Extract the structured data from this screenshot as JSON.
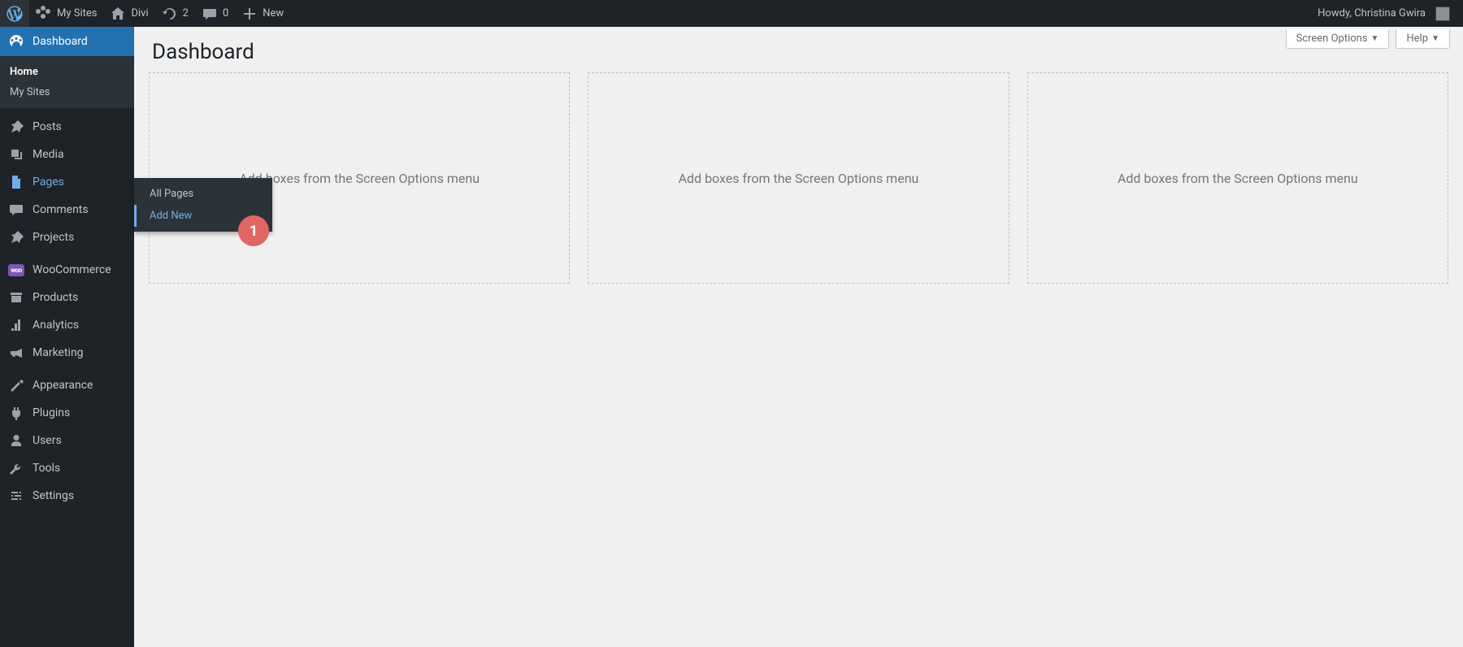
{
  "adminbar": {
    "my_sites": "My Sites",
    "site_name": "Divi",
    "updates_count": "2",
    "comments_count": "0",
    "new_label": "New",
    "greeting": "Howdy, Christina Gwira"
  },
  "sidebar": {
    "items": [
      {
        "label": "Dashboard"
      },
      {
        "label": "Posts"
      },
      {
        "label": "Media"
      },
      {
        "label": "Pages"
      },
      {
        "label": "Comments"
      },
      {
        "label": "Projects"
      },
      {
        "label": "WooCommerce"
      },
      {
        "label": "Products"
      },
      {
        "label": "Analytics"
      },
      {
        "label": "Marketing"
      },
      {
        "label": "Appearance"
      },
      {
        "label": "Plugins"
      },
      {
        "label": "Users"
      },
      {
        "label": "Tools"
      },
      {
        "label": "Settings"
      }
    ],
    "dashboard_sub": {
      "home": "Home",
      "my_sites": "My Sites"
    },
    "pages_flyout": {
      "all_pages": "All Pages",
      "add_new": "Add New"
    }
  },
  "screen_links": {
    "screen_options": "Screen Options",
    "help": "Help"
  },
  "page": {
    "title": "Dashboard",
    "box_placeholder": "Add boxes from the Screen Options menu"
  },
  "annotations": {
    "step1": "1"
  }
}
